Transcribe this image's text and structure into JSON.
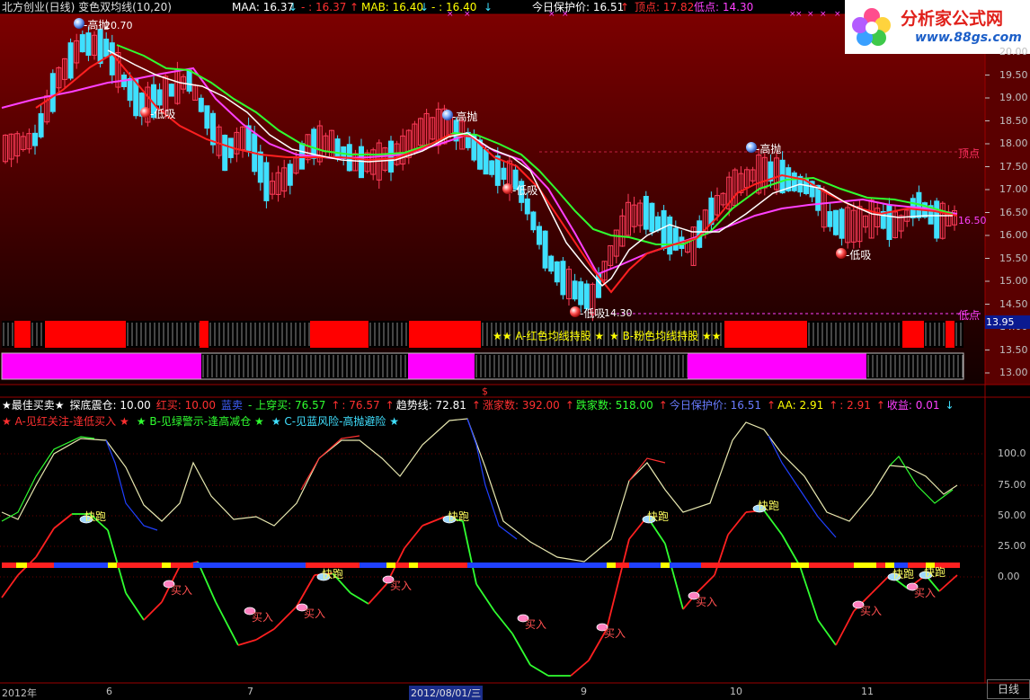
{
  "top_header": {
    "title": "北方创业(日线) 变色双均线(10,20)",
    "maa_label": "MAA: 16.37",
    "maa_arrow": "↓",
    "maa_sub": "- : 16.37",
    "maa_sub_arrow": "↑",
    "mab_label": "MAB: 16.40",
    "mab_arrow": "↓",
    "mab_sub": "- : 16.40",
    "mab_sub_arrow": "↓",
    "protect_label": "今日保护价: 16.51",
    "protect_arrow": "↑",
    "top_label": "顶点: 17.82",
    "low_label": "低点: 14.30"
  },
  "logo": {
    "brand": "分析家公式网",
    "url": "www.88gs.com"
  },
  "main_panel": {
    "price_axis": [
      "20.00",
      "19.50",
      "19.00",
      "18.50",
      "18.00",
      "17.50",
      "17.00",
      "16.50",
      "16.00",
      "15.50",
      "15.00",
      "14.50",
      "14.00",
      "13.50",
      "13.00"
    ],
    "current_price": "16.50",
    "cursor_price": "13.95",
    "peak_price_label": "20.70",
    "low_price_label": "14.30",
    "top_line_label": "顶点",
    "low_line_label": "低点",
    "high_throw_label": "高抛",
    "low_suck_label": "低吸",
    "legend_red": "★★ A-红色均线持股 ★",
    "legend_pink": "★ B-粉色均线持股 ★★",
    "dollar_mark": "$"
  },
  "sub_header": {
    "line1": [
      {
        "text": "★最佳买卖★",
        "color": "#ffffff"
      },
      {
        "text": "探底震仓: 10.00",
        "color": "#ffffff"
      },
      {
        "text": "红买: 10.00",
        "color": "#ff3030"
      },
      {
        "text": "蓝卖",
        "color": "#4060ff"
      },
      {
        "text": "- 上穿买: 76.57",
        "color": "#30ff30"
      },
      {
        "text": "↑",
        "color": "#ff3030"
      },
      {
        "text": ": 76.57",
        "color": "#ff3030"
      },
      {
        "text": "↑",
        "color": "#ff3030"
      },
      {
        "text": "趋势线: 72.81",
        "color": "#ffffff"
      },
      {
        "text": "↑",
        "color": "#ff3030"
      },
      {
        "text": "涨家数: 392.00",
        "color": "#ff3030"
      },
      {
        "text": "↑",
        "color": "#ff3030"
      },
      {
        "text": "跌家数: 518.00",
        "color": "#30ff30"
      },
      {
        "text": "↑",
        "color": "#ff3030"
      },
      {
        "text": "今日保护价: 16.51",
        "color": "#6a7cff"
      },
      {
        "text": "↑",
        "color": "#ff3030"
      },
      {
        "text": "AA: 2.91",
        "color": "#ffff00"
      },
      {
        "text": "↑",
        "color": "#ff3030"
      },
      {
        "text": ": 2.91",
        "color": "#ff3030"
      },
      {
        "text": "↑",
        "color": "#ff3030"
      },
      {
        "text": "收益: 0.01",
        "color": "#ff40ff"
      },
      {
        "text": "↓",
        "color": "#40e0ff"
      }
    ],
    "line2": [
      {
        "text": "★ A-见红关注-逢低买入 ★",
        "color": "#ff3030"
      },
      {
        "text": "★ B-见绿警示-逢高减仓 ★",
        "color": "#30ff30"
      },
      {
        "text": "★ C-见蓝风险-高抛避险 ★",
        "color": "#40e0ff"
      }
    ]
  },
  "sub_panel": {
    "axis": [
      "100.0",
      "75.00",
      "50.00",
      "25.00",
      "0.00"
    ],
    "run_label": "快跑",
    "buy_label": "买入"
  },
  "time_axis": {
    "labels": [
      "2012年",
      "6",
      "7",
      "2012/08/01/三",
      "9",
      "10",
      "11"
    ],
    "period": "日线"
  },
  "colors": {
    "up_candle": "#ff3c5a",
    "down_candle": "#3fe0ff",
    "ma_white": "#ffffff",
    "ma_green": "#30ff30",
    "ma_red": "#ff2020",
    "ma_magenta": "#ff40ff",
    "band_red": "#ff0000",
    "band_pink": "#ff00ff"
  }
}
